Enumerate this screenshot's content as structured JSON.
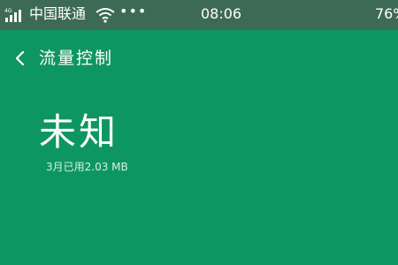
{
  "status_bar": {
    "carrier": "中国联通",
    "more": "•••",
    "time": "08:06",
    "battery": "76%",
    "icons": [
      "signal-icon",
      "wifi-icon"
    ]
  },
  "header": {
    "title": "流量控制",
    "back_icon": "chevron-left-icon"
  },
  "main": {
    "usage_value": "未知",
    "usage_note": "3月已用2.03 MB"
  },
  "colors": {
    "background": "#0e9660",
    "status_bar": "#3d6a55"
  }
}
